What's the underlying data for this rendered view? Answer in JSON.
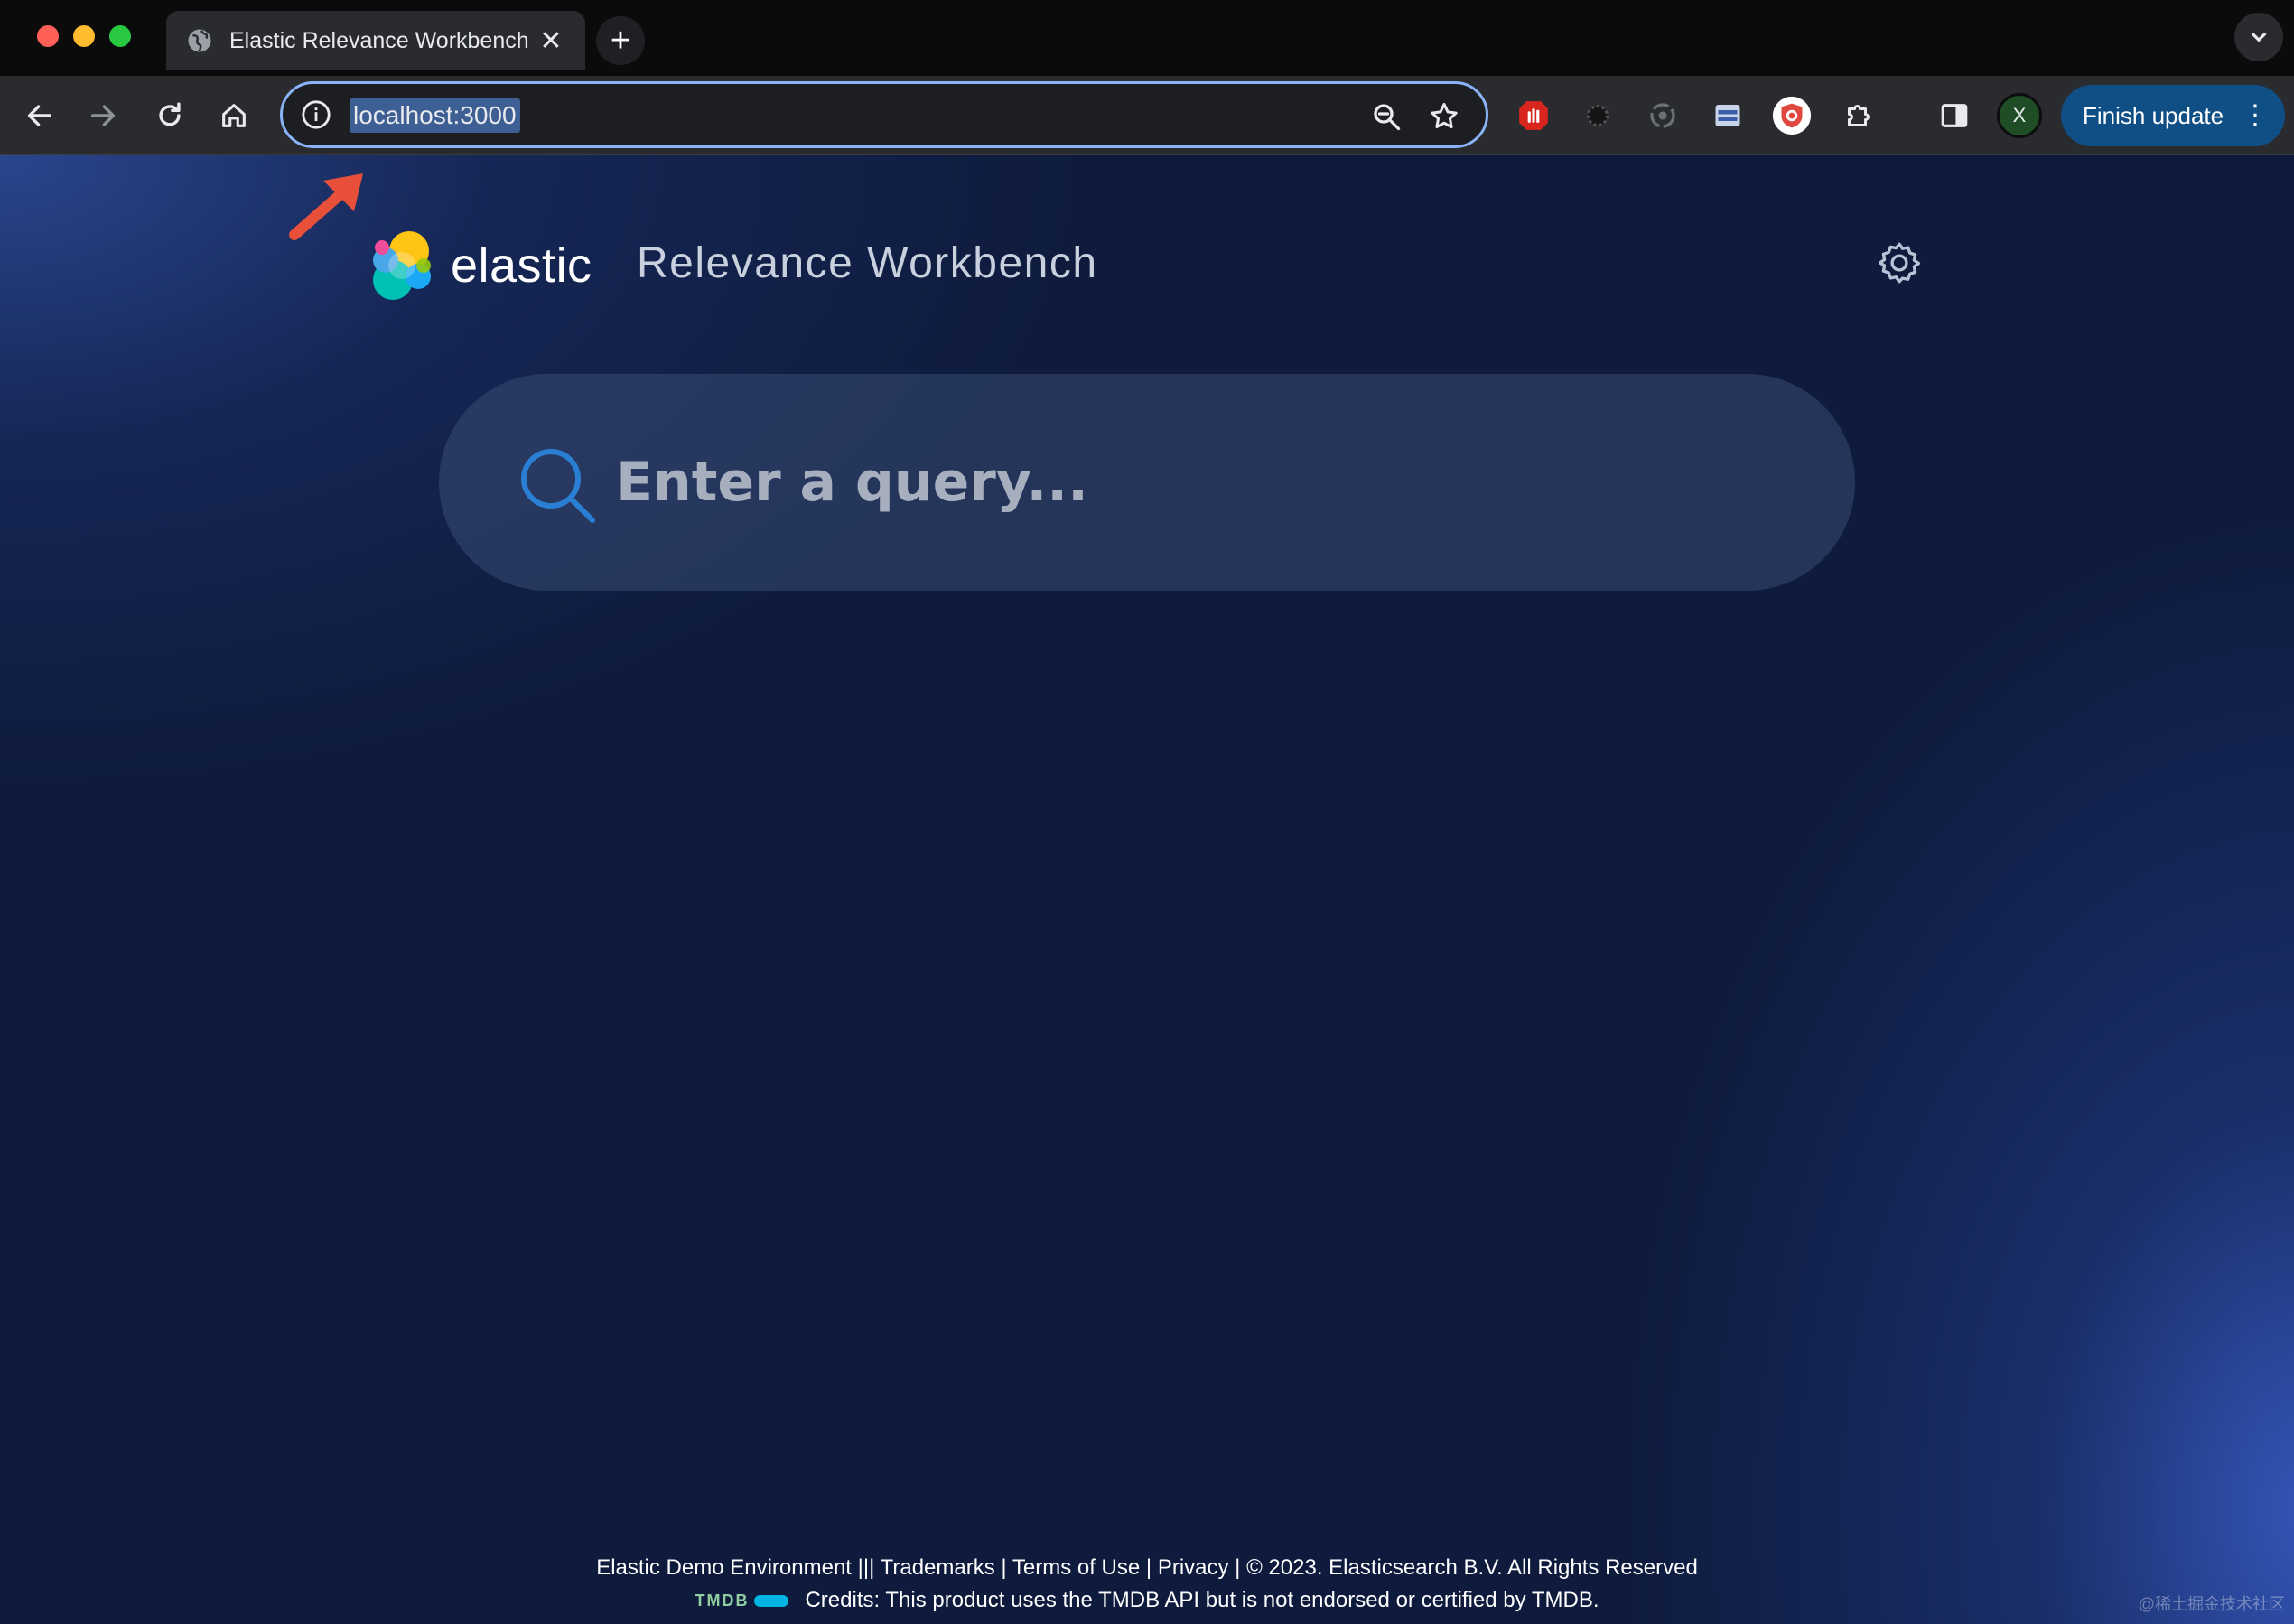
{
  "window": {
    "tab_title": "Elastic Relevance Workbench",
    "close_glyph": "✕",
    "new_tab_glyph": "+"
  },
  "toolbar": {
    "url": "localhost:3000",
    "finish_update_label": "Finish update",
    "profile_initial": "X",
    "menu_glyph": "⋮"
  },
  "page": {
    "brand_name": "elastic",
    "app_title": "Relevance Workbench",
    "search_placeholder": "Enter a query...",
    "search_value": ""
  },
  "footer": {
    "links": [
      "Elastic Demo Environment |||",
      "Trademarks",
      "Terms of Use",
      "Privacy",
      "© 2023. Elasticsearch B.V. All Rights Reserved"
    ],
    "tmdb_label": "TMDB",
    "credits": "Credits: This product uses the TMDB API but is not endorsed or certified by TMDB."
  },
  "watermark": "@稀土掘金技术社区",
  "icons": {
    "back": "arrow-left-icon",
    "forward": "arrow-right-icon",
    "reload": "reload-icon",
    "home": "home-icon",
    "info": "info-icon",
    "zoom": "zoom-icon",
    "bookmark": "star-icon",
    "settings": "gear-icon",
    "search": "search-icon"
  },
  "colors": {
    "accent": "#8ab4f8",
    "url_highlight": "#3d5f94",
    "page_bg": "#0e1b3d",
    "finish_update": "#104f86",
    "annotation_arrow": "#e8503a"
  }
}
